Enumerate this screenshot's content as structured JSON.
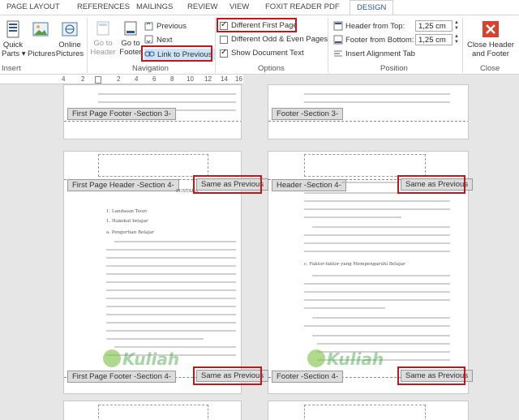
{
  "tabs": [
    "PAGE LAYOUT",
    "REFERENCES",
    "MAILINGS",
    "REVIEW",
    "VIEW",
    "FOXIT READER PDF",
    "DESIGN"
  ],
  "ribbon": {
    "insert": {
      "quick_parts": "Quick\nParts ▾",
      "pictures": "Pictures",
      "online_pictures": "Online\nPictures",
      "group": "Insert"
    },
    "navigation": {
      "go_to_header": "Go to\nHeader",
      "go_to_footer": "Go to\nFooter",
      "previous": "Previous",
      "next": "Next",
      "link_to_previous": "Link to Previous",
      "group": "Navigation"
    },
    "options": {
      "different_first_page": "Different First Page",
      "different_odd_even": "Different Odd & Even Pages",
      "show_document_text": "Show Document Text",
      "group": "Options"
    },
    "position": {
      "header_from_top": "Header from Top:",
      "header_value": "1,25 cm",
      "footer_from_bottom": "Footer from Bottom:",
      "footer_value": "1,25 cm",
      "insert_alignment_tab": "Insert Alignment Tab",
      "group": "Position"
    },
    "close": {
      "label": "Close Header\nand Footer",
      "group": "Close"
    }
  },
  "ruler": [
    "4",
    "2",
    "2",
    "4",
    "6",
    "8",
    "10",
    "12",
    "14",
    "16"
  ],
  "pages": {
    "top_left_footer": "First Page Footer -Section 3-",
    "top_right_footer": "Footer -Section 3-",
    "mid_left_header": "First Page Header -Section 4-",
    "mid_right_header": "Header -Section 4-",
    "same_as_previous": "Same as Previous",
    "mid_left_footer": "First Page Footer -Section 4-",
    "mid_right_footer": "Footer -Section 4-",
    "pustaka": "PUSTAKA",
    "left_lines": [
      "1. Landasan Teori",
      "1. Hakekat belajar",
      "a. Pengertian Belajar"
    ],
    "right_heading": "c. Faktor-faktor yang Mempengaruhi Belajar"
  },
  "watermark": "Kuliah",
  "colors": {
    "accent": "#2b579a",
    "highlight": "#c0161c",
    "close": "#d9412b"
  }
}
